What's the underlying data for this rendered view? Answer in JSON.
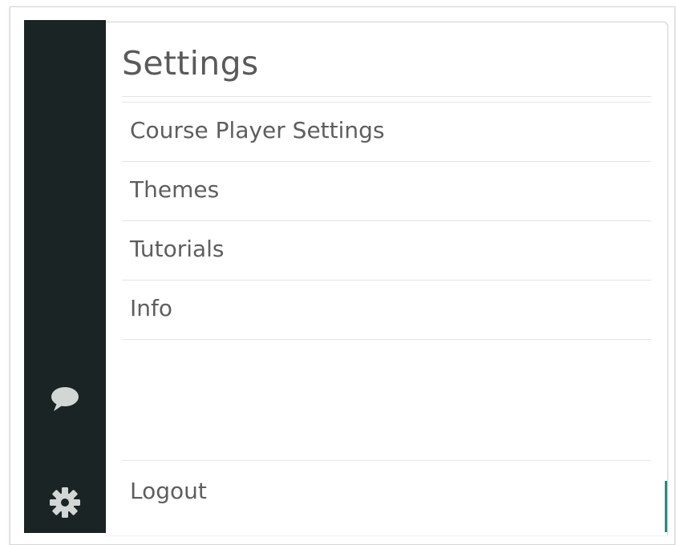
{
  "panel": {
    "title": "Settings"
  },
  "menu": {
    "items": [
      {
        "label": "Course Player Settings"
      },
      {
        "label": "Themes"
      },
      {
        "label": "Tutorials"
      },
      {
        "label": "Info"
      }
    ],
    "logout_label": "Logout"
  },
  "sidebar": {
    "icons": [
      "chat-icon",
      "gear-icon"
    ]
  },
  "colors": {
    "sidebar_bg": "#1a2424",
    "icon": "#d2d7d6",
    "text": "#5e5e5e",
    "divider": "#e3e3e3",
    "accent": "#2b8a7a"
  }
}
